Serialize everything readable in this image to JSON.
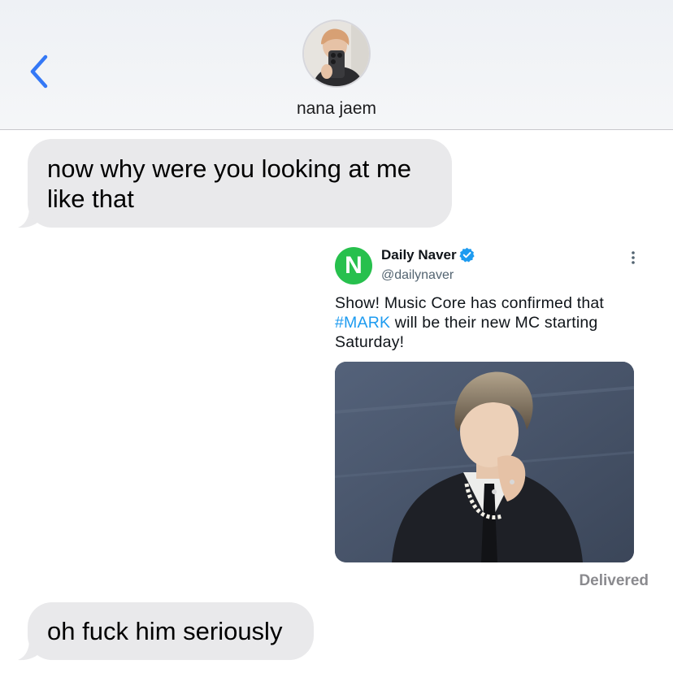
{
  "header": {
    "contact_name": "nana jaem",
    "back_icon": "chevron-left-icon",
    "accent_color": "#3478f6"
  },
  "messages": [
    {
      "direction": "incoming",
      "text": "now why were you looking at me like that"
    },
    {
      "direction": "outgoing",
      "type": "tweet-card",
      "tweet": {
        "author": "Daily Naver",
        "handle": "@dailynaver",
        "logo_letter": "N",
        "verified": true,
        "text_before": "Show! Music Core has confirmed that ",
        "hashtag": "#MARK",
        "text_after": " will be their new MC starting Saturday!",
        "media": "photo"
      }
    },
    {
      "direction": "incoming",
      "text": "oh fuck him seriously"
    }
  ],
  "status": {
    "delivered": "Delivered"
  },
  "colors": {
    "incoming_bubble": "#e9e9eb",
    "hashtag": "#1d9bf0",
    "naver_green": "#27c04d",
    "verified_blue": "#1d9bf0"
  }
}
